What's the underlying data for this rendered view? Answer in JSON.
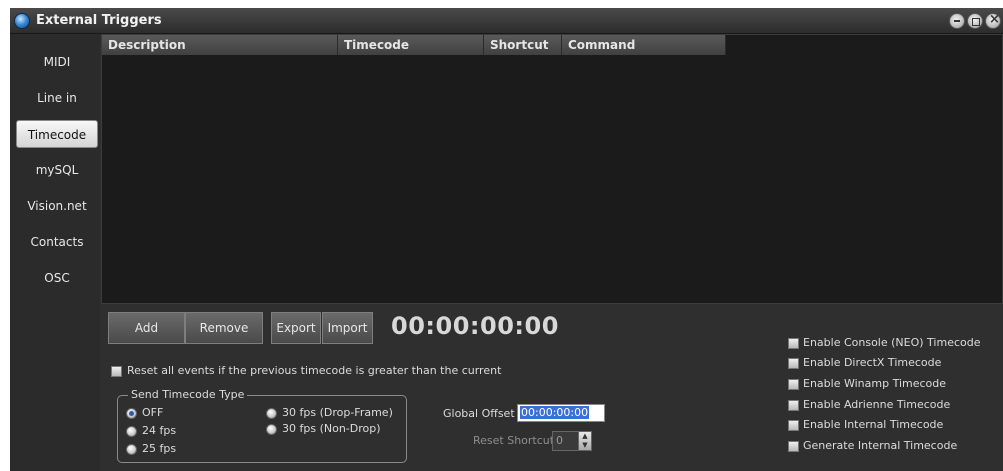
{
  "window": {
    "title": "External Triggers"
  },
  "sidebar": {
    "items": [
      {
        "label": "MIDI",
        "active": false
      },
      {
        "label": "Line in",
        "active": false
      },
      {
        "label": "Timecode",
        "active": true
      },
      {
        "label": "mySQL",
        "active": false
      },
      {
        "label": "Vision.net",
        "active": false
      },
      {
        "label": "Contacts",
        "active": false
      },
      {
        "label": "OSC",
        "active": false
      }
    ]
  },
  "table": {
    "columns": [
      "Description",
      "Timecode",
      "Shortcut",
      "Command"
    ],
    "rows": []
  },
  "toolbar": {
    "add_label": "Add",
    "remove_label": "Remove",
    "export_label": "Export",
    "import_label": "Import"
  },
  "timecode_display": "00:00:00:00",
  "reset_option": {
    "label": "Reset all events if the previous timecode is greater than the current",
    "checked": false
  },
  "send_type": {
    "title": "Send Timecode Type",
    "options": [
      {
        "label": "OFF",
        "checked": true
      },
      {
        "label": "24 fps",
        "checked": false
      },
      {
        "label": "25 fps",
        "checked": false
      },
      {
        "label": "30 fps (Drop-Frame)",
        "checked": false
      },
      {
        "label": "30 fps (Non-Drop)",
        "checked": false
      }
    ]
  },
  "global_offset": {
    "label": "Global Offset",
    "value": "00:00:00:00"
  },
  "reset_shortcut": {
    "label": "Reset Shortcut",
    "value": "0"
  },
  "enable_options": [
    {
      "label": "Enable Console (NEO) Timecode",
      "checked": false
    },
    {
      "label": "Enable DirectX Timecode",
      "checked": false
    },
    {
      "label": "Enable Winamp Timecode",
      "checked": false
    },
    {
      "label": "Enable Adrienne Timecode",
      "checked": false
    },
    {
      "label": "Enable Internal Timecode",
      "checked": false
    },
    {
      "label": "Generate Internal Timecode",
      "checked": false
    }
  ],
  "colors": {
    "accent": "#3a6fd8",
    "window_bg": "#2f2f2f",
    "table_bg": "#1b1b1b"
  }
}
